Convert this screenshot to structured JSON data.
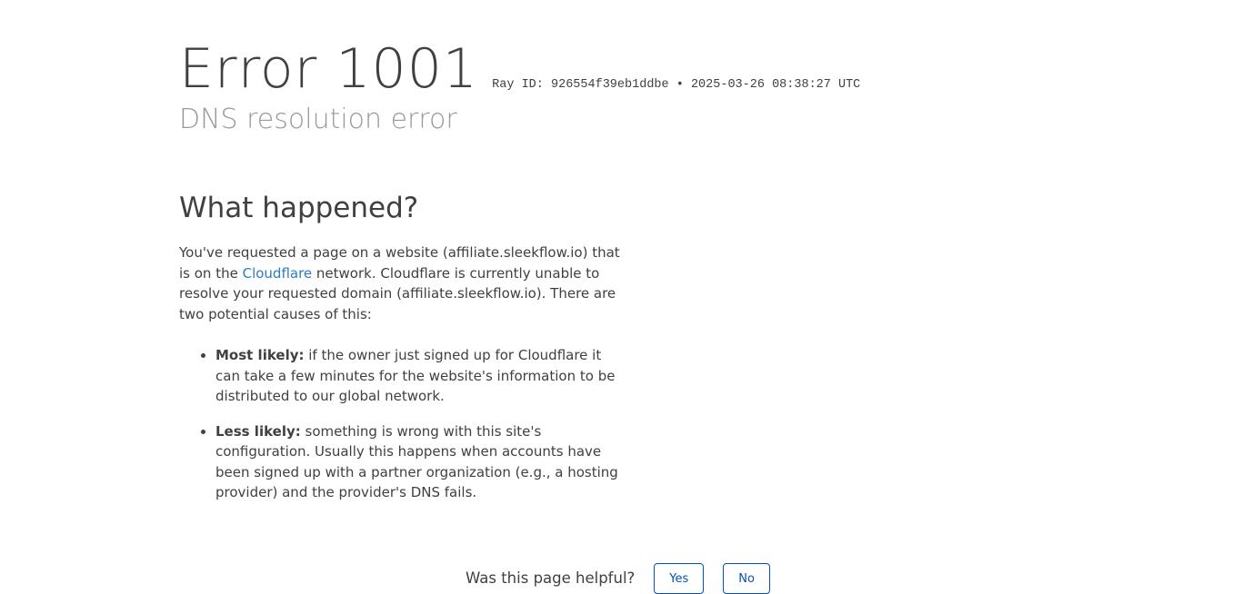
{
  "header": {
    "title": "Error 1001",
    "ray_id_label": "Ray ID:",
    "ray_id": "926554f39eb1ddbe",
    "separator": "•",
    "timestamp": "2025-03-26 08:38:27 UTC",
    "subtitle": "DNS resolution error"
  },
  "section": {
    "heading": "What happened?",
    "intro_before_link": "You've requested a page on a website (affiliate.sleekflow.io) that is on the ",
    "link": "Cloudflare",
    "intro_after_link": " network. Cloudflare is currently unable to resolve your requested domain (affiliate.sleekflow.io). There are two potential causes of this:",
    "causes": [
      {
        "label": "Most likely:",
        "text": " if the owner just signed up for Cloudflare it can take a few minutes for the website's information to be distributed to our global network."
      },
      {
        "label": "Less likely:",
        "text": " something is wrong with this site's configuration. Usually this happens when accounts have been signed up with a partner organization (e.g., a hosting provider) and the provider's DNS fails."
      }
    ]
  },
  "feedback": {
    "question": "Was this page helpful?",
    "yes": "Yes",
    "no": "No"
  }
}
